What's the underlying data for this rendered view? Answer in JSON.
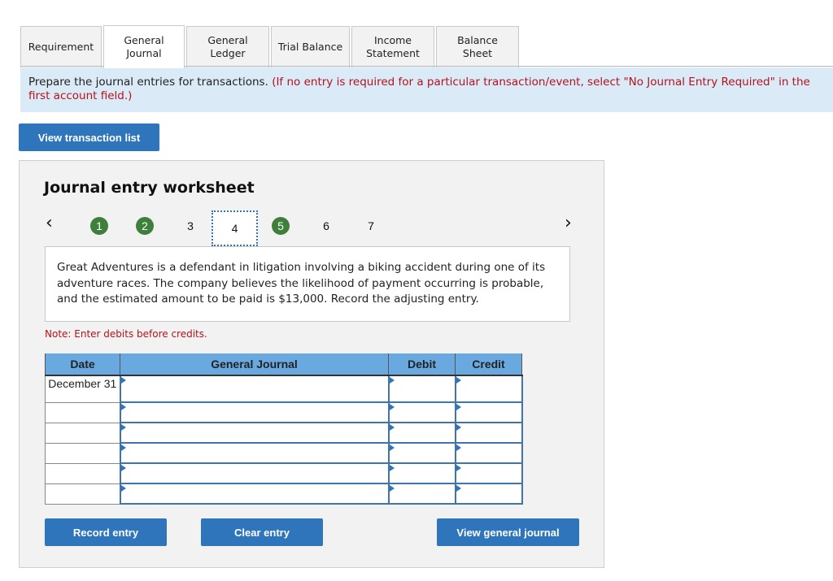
{
  "tabs": [
    {
      "label": "Requirement",
      "active": false
    },
    {
      "label": "General Journal",
      "active": true
    },
    {
      "label": "General Ledger",
      "active": false
    },
    {
      "label": "Trial Balance",
      "active": false
    },
    {
      "label": "Income Statement",
      "active": false
    },
    {
      "label": "Balance Sheet",
      "active": false
    }
  ],
  "banner": {
    "text": "Prepare the journal entries for transactions.",
    "note": "(If no entry is required for a particular transaction/event, select \"No Journal Entry Required\" in the first account field.)"
  },
  "view_transaction_list_label": "View transaction list",
  "worksheet": {
    "title": "Journal entry worksheet",
    "prev_icon": "‹",
    "next_icon": "›",
    "steps": [
      {
        "label": "1",
        "state": "done"
      },
      {
        "label": "2",
        "state": "done"
      },
      {
        "label": "3",
        "state": "pending"
      },
      {
        "label": "4",
        "state": "current"
      },
      {
        "label": "5",
        "state": "done"
      },
      {
        "label": "6",
        "state": "pending"
      },
      {
        "label": "7",
        "state": "pending"
      }
    ],
    "scenario": "Great Adventures is a defendant in litigation involving a biking accident during one of its adventure races. The company believes the likelihood of payment occurring is probable, and the estimated amount to be paid is $13,000. Record the adjusting entry.",
    "note": "Note: Enter debits before credits.",
    "table": {
      "headers": [
        "Date",
        "General Journal",
        "Debit",
        "Credit"
      ],
      "rows": [
        {
          "date": "December 31",
          "account": "",
          "debit": "",
          "credit": ""
        },
        {
          "date": "",
          "account": "",
          "debit": "",
          "credit": ""
        },
        {
          "date": "",
          "account": "",
          "debit": "",
          "credit": ""
        },
        {
          "date": "",
          "account": "",
          "debit": "",
          "credit": ""
        },
        {
          "date": "",
          "account": "",
          "debit": "",
          "credit": ""
        },
        {
          "date": "",
          "account": "",
          "debit": "",
          "credit": ""
        }
      ]
    },
    "buttons": {
      "record": "Record entry",
      "clear": "Clear entry",
      "view_general_journal": "View general journal"
    }
  },
  "colors": {
    "accent_blue": "#2f75bb",
    "header_blue": "#6aa9e0",
    "done_green": "#3e7f3b",
    "note_red": "#b5121b",
    "banner_bg": "#dbeaf7"
  }
}
